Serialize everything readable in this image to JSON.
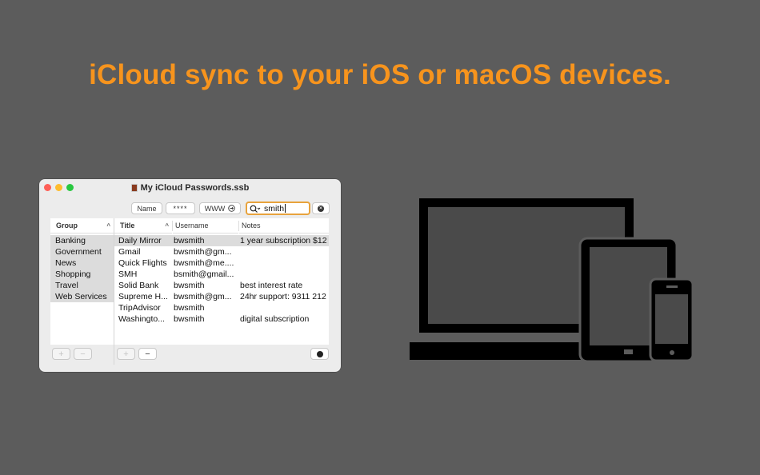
{
  "headline": "iCloud sync to your iOS or macOS devices.",
  "window": {
    "title": "My iCloud Passwords.ssb",
    "toolbar": {
      "name_btn": "Name",
      "password_btn": "****",
      "www_btn": "WWW",
      "search_value": "smith",
      "search_icon": "search-icon",
      "clear_icon": "clear-circle-icon"
    },
    "groups": {
      "header": "Group",
      "items": [
        "Banking",
        "Government",
        "News",
        "Shopping",
        "Travel",
        "Web Services"
      ]
    },
    "table": {
      "headers": {
        "title": "Title",
        "username": "Username",
        "notes": "Notes"
      },
      "rows": [
        {
          "title": "Daily Mirror",
          "username": "bwsmith",
          "notes": "1 year subscription $12"
        },
        {
          "title": "Gmail",
          "username": "bwsmith@gm...",
          "notes": ""
        },
        {
          "title": "Quick Flights",
          "username": "bwsmith@me....",
          "notes": ""
        },
        {
          "title": "SMH",
          "username": "bsmith@gmail...",
          "notes": ""
        },
        {
          "title": "Solid Bank",
          "username": "bwsmith",
          "notes": "best interest rate"
        },
        {
          "title": "Supreme H...",
          "username": "bwsmith@gm...",
          "notes": "24hr support: 9311 212"
        },
        {
          "title": "TripAdvisor",
          "username": "bwsmith",
          "notes": ""
        },
        {
          "title": "Washingto...",
          "username": "bwsmith",
          "notes": "digital subscription"
        }
      ]
    },
    "bottom": {
      "plus": "+",
      "minus": "−"
    }
  },
  "colors": {
    "headline": "#f7941d",
    "background": "#5c5c5c",
    "search_focus": "#e8a33c"
  }
}
